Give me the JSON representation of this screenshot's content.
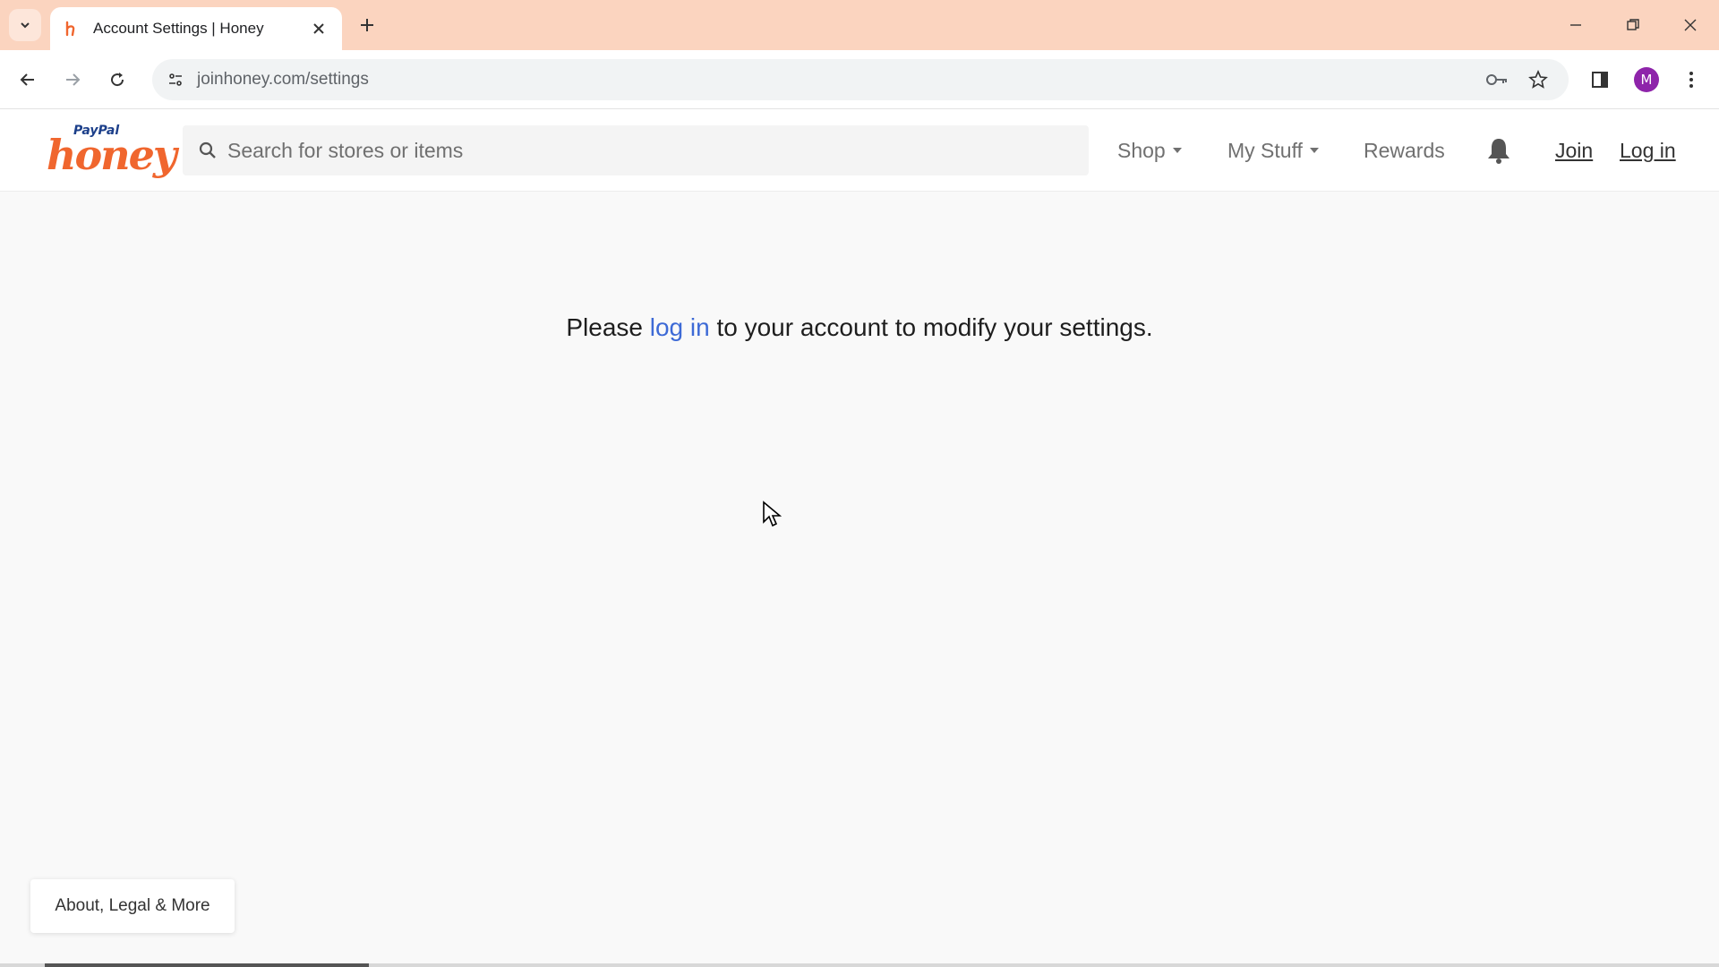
{
  "browser": {
    "tab_title": "Account Settings | Honey",
    "url": "joinhoney.com/settings",
    "profile_initial": "M",
    "tabstrip_color": "#fbd4bf"
  },
  "site": {
    "logo_paypal": "PayPal",
    "logo_honey": "honey",
    "search_placeholder": "Search for stores or items",
    "nav": {
      "shop": "Shop",
      "my_stuff": "My Stuff",
      "rewards": "Rewards",
      "join": "Join",
      "login": "Log in"
    },
    "brand_color": "#f0662e"
  },
  "main": {
    "message_before": "Please ",
    "message_link": "log in",
    "message_after": " to your account to modify your settings.",
    "link_color": "#3d6ad6"
  },
  "footer": {
    "about_label": "About, Legal & More"
  }
}
